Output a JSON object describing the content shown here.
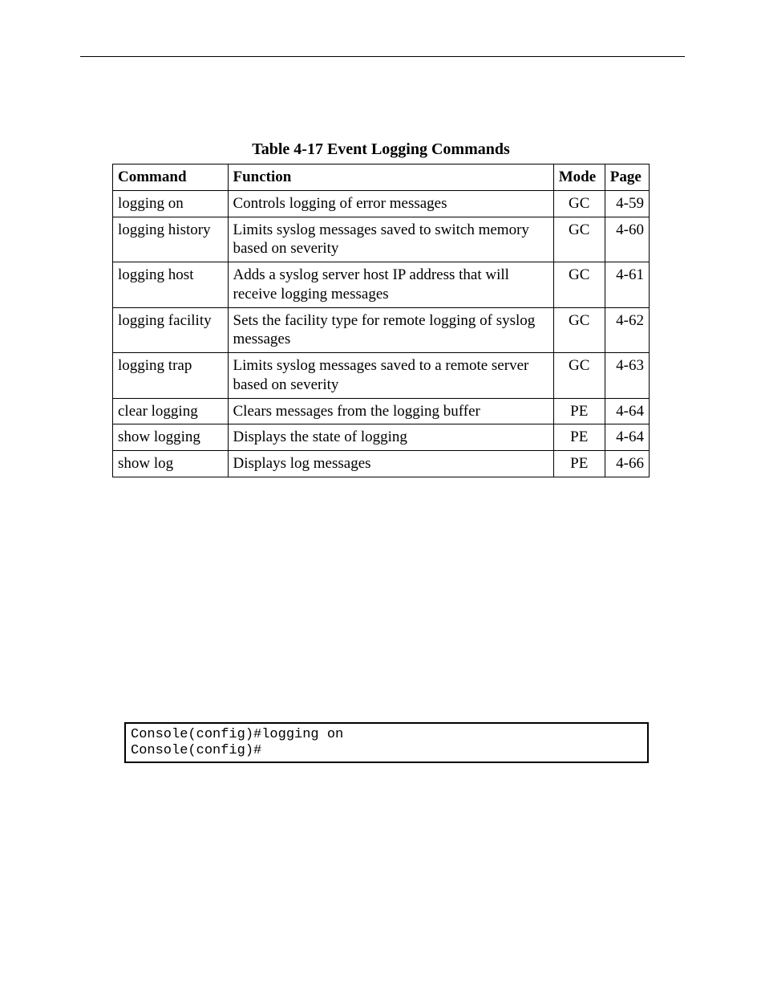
{
  "table": {
    "caption": "Table 4-17  Event Logging Commands",
    "headers": {
      "command": "Command",
      "function": "Function",
      "mode": "Mode",
      "page": "Page"
    },
    "rows": [
      {
        "command": "logging on",
        "function": "Controls logging of error messages",
        "mode": "GC",
        "page": "4-59"
      },
      {
        "command": "logging history",
        "function": "Limits syslog messages saved to switch memory based on severity",
        "mode": "GC",
        "page": "4-60"
      },
      {
        "command": "logging host",
        "function": "Adds a syslog server host IP address that will receive logging messages",
        "mode": "GC",
        "page": "4-61"
      },
      {
        "command": "logging facility",
        "function": "Sets the facility type for remote logging of syslog messages",
        "mode": "GC",
        "page": "4-62"
      },
      {
        "command": "logging trap",
        "function": "Limits syslog messages saved to a remote server based on severity",
        "mode": "GC",
        "page": "4-63"
      },
      {
        "command": "clear logging",
        "function": "Clears messages from the logging buffer",
        "mode": "PE",
        "page": "4-64"
      },
      {
        "command": "show logging",
        "function": "Displays the state of logging",
        "mode": "PE",
        "page": "4-64"
      },
      {
        "command": "show log",
        "function": "Displays log messages",
        "mode": "PE",
        "page": "4-66"
      }
    ]
  },
  "example": "Console(config)#logging on\nConsole(config)#"
}
